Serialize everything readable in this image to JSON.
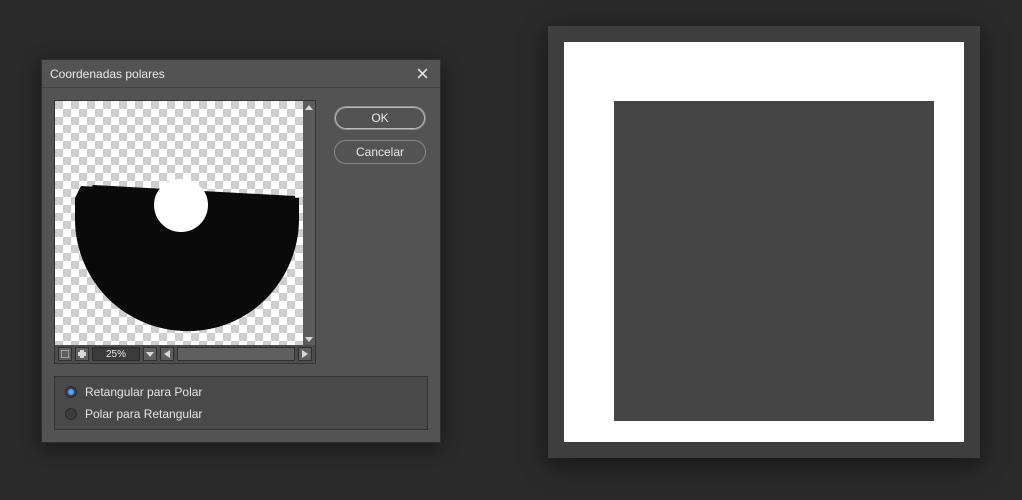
{
  "dialog": {
    "title": "Coordenadas polares",
    "buttons": {
      "ok": "OK",
      "cancel": "Cancelar"
    },
    "preview": {
      "zoom": "25%"
    },
    "options": {
      "rect_to_polar": "Retangular para Polar",
      "polar_to_rect": "Polar para Retangular",
      "selected": "rect_to_polar"
    }
  }
}
